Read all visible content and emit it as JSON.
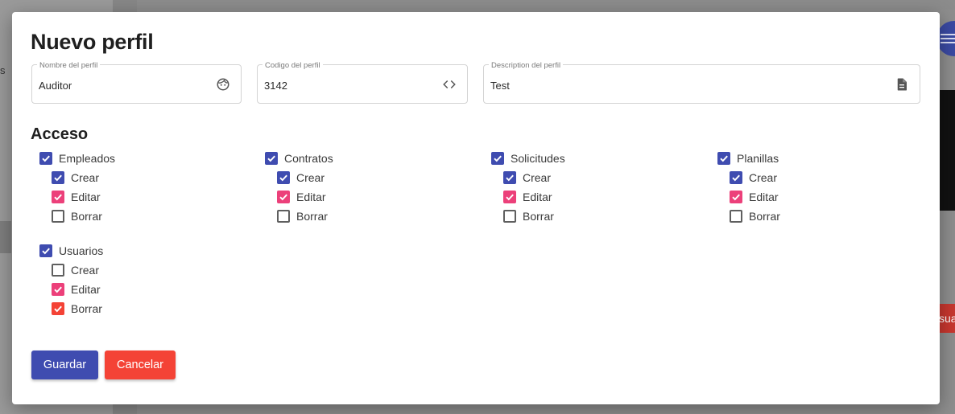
{
  "background": {
    "sidebar_partial_text": "s",
    "red_button_partial_text": "sua"
  },
  "modal": {
    "title": "Nuevo perfil",
    "fields": [
      {
        "label": "Nombre del perfil",
        "value": "Auditor",
        "icon": "face-icon"
      },
      {
        "label": "Codigo del perfil",
        "value": "3142",
        "icon": "code-icon"
      },
      {
        "label": "Description del perfil",
        "value": "Test",
        "icon": "document-icon"
      }
    ],
    "access_title": "Acceso",
    "groups": [
      {
        "name": "Empleados",
        "checked": true,
        "perms": [
          {
            "label": "Crear",
            "state": "blue"
          },
          {
            "label": "Editar",
            "state": "pink"
          },
          {
            "label": "Borrar",
            "state": "empty"
          }
        ]
      },
      {
        "name": "Contratos",
        "checked": true,
        "perms": [
          {
            "label": "Crear",
            "state": "blue"
          },
          {
            "label": "Editar",
            "state": "pink"
          },
          {
            "label": "Borrar",
            "state": "empty"
          }
        ]
      },
      {
        "name": "Solicitudes",
        "checked": true,
        "perms": [
          {
            "label": "Crear",
            "state": "blue"
          },
          {
            "label": "Editar",
            "state": "pink"
          },
          {
            "label": "Borrar",
            "state": "empty"
          }
        ]
      },
      {
        "name": "Planillas",
        "checked": true,
        "perms": [
          {
            "label": "Crear",
            "state": "blue"
          },
          {
            "label": "Editar",
            "state": "pink"
          },
          {
            "label": "Borrar",
            "state": "empty"
          }
        ]
      },
      {
        "name": "Usuarios",
        "checked": true,
        "perms": [
          {
            "label": "Crear",
            "state": "empty"
          },
          {
            "label": "Editar",
            "state": "pink"
          },
          {
            "label": "Borrar",
            "state": "red"
          }
        ]
      }
    ],
    "buttons": {
      "save": "Guardar",
      "cancel": "Cancelar"
    }
  },
  "colors": {
    "checkbox_blue": "#3f4cb0",
    "checkbox_pink": "#ec407a",
    "checkbox_red": "#f44336",
    "save_button": "#3f4cb0",
    "cancel_button": "#f44336"
  }
}
